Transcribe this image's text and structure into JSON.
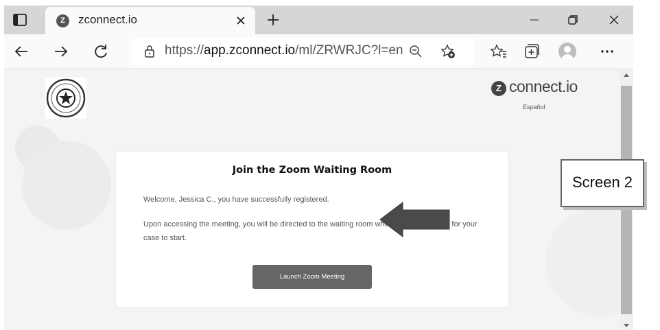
{
  "browser": {
    "tab": {
      "favicon_letter": "Z",
      "title": "zconnect.io"
    },
    "address_bar": {
      "url_prefix": "https://",
      "url_domain": "app.zconnect.io",
      "url_path": "/ml/ZRWRJC?l=en"
    },
    "icons": [
      "tab-actions-icon",
      "close-icon",
      "plus-icon",
      "minimize-icon",
      "restore-icon",
      "back-icon",
      "forward-icon",
      "refresh-icon",
      "lock-icon",
      "zoom-out-icon",
      "add-favorite-icon",
      "favorites-icon",
      "collections-icon",
      "profile-icon",
      "more-icon"
    ]
  },
  "page": {
    "brand": {
      "logo_letter": "Z",
      "name": "connect.io",
      "language_link": "Español"
    },
    "card": {
      "title": "Join the Zoom Waiting Room",
      "welcome": "Welcome, Jessica C., you have successfully registered.",
      "info": "Upon accessing the meeting, you will be directed to the waiting room where you should wait for your case to start.",
      "launch_button": "Launch Zoom Meeting"
    }
  },
  "annotation": {
    "screen_label": "Screen 2"
  },
  "colors": {
    "tab_strip": "#d6d6d6",
    "page_bg": "#f4f4f4",
    "button_bg": "#666666",
    "arrow": "#4a4a4a"
  }
}
